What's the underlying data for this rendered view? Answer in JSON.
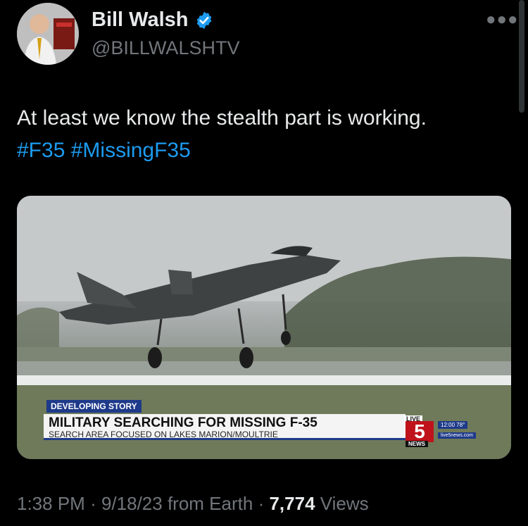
{
  "author": {
    "display_name": "Bill Walsh",
    "handle": "@BILLWALSHTV",
    "verified_icon": "verified-badge-icon",
    "verified_color": "#1d9bf0"
  },
  "tweet": {
    "text": "At least we know the stealth part is working.",
    "hashtags": [
      "#F35",
      "#MissingF35"
    ]
  },
  "media": {
    "lower_third": {
      "tag": "DEVELOPING STORY",
      "headline": "MILITARY SEARCHING FOR MISSING F-35",
      "subline": "SEARCH AREA FOCUSED ON LAKES MARION/MOULTRIE"
    },
    "station_bug": {
      "live": "LIVE",
      "channel": "5",
      "news": "NEWS",
      "time_temp": "12:00 78°",
      "site": "live5news.com"
    }
  },
  "meta": {
    "time": "1:38 PM",
    "date": "9/18/23",
    "source": "from Earth",
    "views_count": "7,774",
    "views_label": "Views",
    "separator": "·"
  },
  "icons": {
    "more": "more-options-icon"
  },
  "colors": {
    "background": "#000000",
    "text": "#e7e9ea",
    "secondary": "#71767b",
    "link": "#1d9bf0"
  }
}
